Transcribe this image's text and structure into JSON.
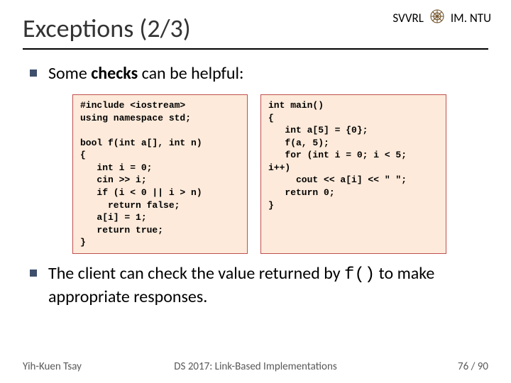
{
  "header": {
    "title": "Exceptions (2/3)",
    "org_left": "SVVRL",
    "org_right": "IM. NTU"
  },
  "bullets": {
    "b1_prefix": "Some ",
    "b1_strong": "checks",
    "b1_suffix": " can be helpful:",
    "b2_prefix": "The client can check the value returned by ",
    "b2_code": "f()",
    "b2_suffix": " to make appropriate responses."
  },
  "code": {
    "left": "#include <iostream>\nusing namespace std;\n\nbool f(int a[], int n)\n{\n   int i = 0;\n   cin >> i;\n   if (i < 0 || i > n)\n     return false;\n   a[i] = 1;\n   return true;\n}",
    "right": "int main()\n{\n   int a[5] = {0};\n   f(a, 5);\n   for (int i = 0; i < 5;\ni++)\n     cout << a[i] << \" \";\n   return 0;\n}"
  },
  "footer": {
    "author": "Yih-Kuen Tsay",
    "course": "DS 2017: Link-Based Implementations",
    "page": "76 / 90"
  }
}
